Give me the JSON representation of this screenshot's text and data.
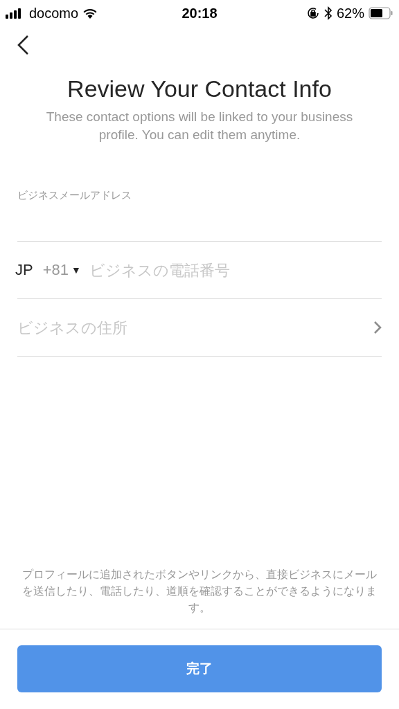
{
  "status_bar": {
    "carrier": "docomo",
    "time": "20:18",
    "battery": "62%"
  },
  "title": "Review Your Contact Info",
  "subtitle": "These contact options will be linked to your business profile. You can edit them anytime.",
  "fields": [
    {
      "kind": "email",
      "label": "ビジネスメールアドレス"
    },
    {
      "kind": "phone",
      "country": "JP",
      "code": "+81",
      "caret": "▼",
      "placeholder": "ビジネスの電話番号"
    },
    {
      "kind": "address",
      "placeholder": "ビジネスの住所"
    }
  ],
  "footer_note": "プロフィールに追加されたボタンやリンクから、直接ビジネスにメールを送信したり、電話したり、道順を確認することができるようになります。",
  "done_button": "完了"
}
